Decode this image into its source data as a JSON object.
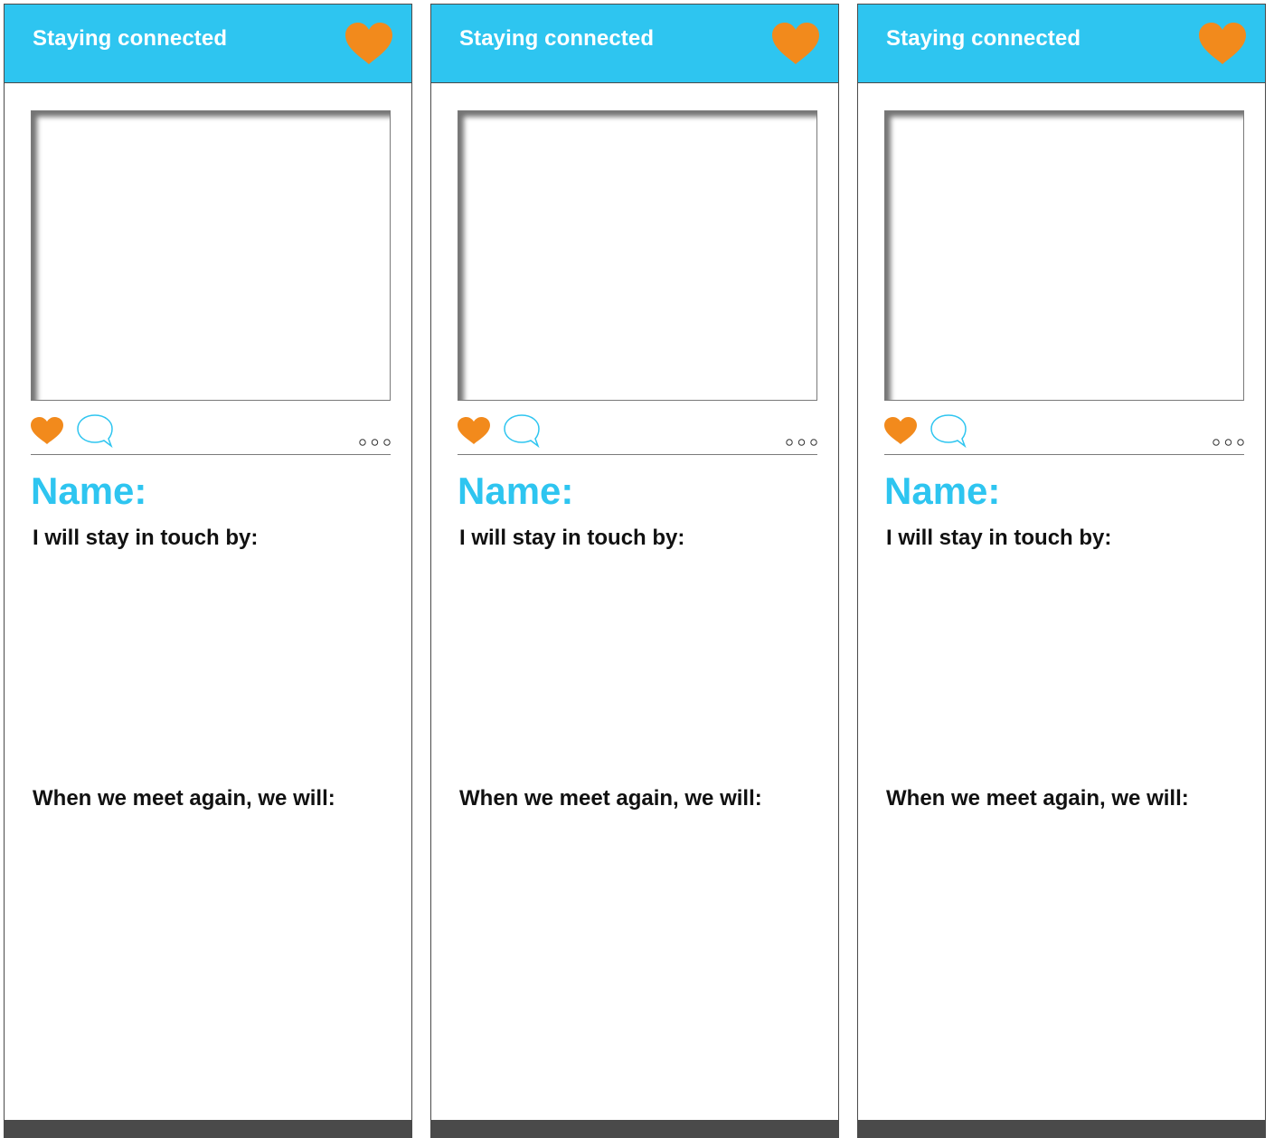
{
  "colors": {
    "accent_blue": "#2ec5f0",
    "heart_orange": "#f28a1c",
    "dark_gray": "#4a4a4a"
  },
  "cards": [
    {
      "header_title": "Staying connected",
      "name_label": "Name:",
      "touch_label": "I will stay in touch by:",
      "meet_label": "When we meet again, we will:",
      "icons": [
        "heart-icon",
        "heart-icon",
        "speech-bubble-icon",
        "more-dots-icon"
      ]
    },
    {
      "header_title": "Staying connected",
      "name_label": "Name:",
      "touch_label": "I will stay in touch by:",
      "meet_label": "When we meet again, we will:",
      "icons": [
        "heart-icon",
        "heart-icon",
        "speech-bubble-icon",
        "more-dots-icon"
      ]
    },
    {
      "header_title": "Staying connected",
      "name_label": "Name:",
      "touch_label": "I will stay in touch by:",
      "meet_label": "When we meet again, we will:",
      "icons": [
        "heart-icon",
        "heart-icon",
        "speech-bubble-icon",
        "more-dots-icon"
      ]
    }
  ]
}
